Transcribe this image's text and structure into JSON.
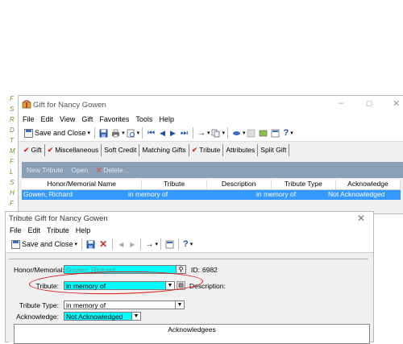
{
  "back_window": {
    "title": "Gift for Nancy Gowen",
    "menu": [
      "File",
      "Edit",
      "View",
      "Gift",
      "Favorites",
      "Tools",
      "Help"
    ],
    "toolbar": {
      "save_close_label": "Save and Close"
    },
    "tabs": [
      "Gift",
      "Miscellaneous",
      "Soft Credit",
      "Matching Gifts",
      "Tribute",
      "Attributes",
      "Split Gift"
    ],
    "checked_tabs": [
      0,
      1,
      4
    ],
    "sub_toolbar": {
      "new_label": "New Tribute",
      "open_label": "Open",
      "delete_label": "Delete..."
    },
    "grid": {
      "headers": [
        "Honor/Memorial Name",
        "Tribute",
        "Description",
        "Tribute Type",
        "Acknowledge"
      ],
      "row": [
        "Gowen, Richard",
        "in memory of",
        "",
        "in memory of",
        "Not Acknowledged"
      ]
    }
  },
  "front_window": {
    "title": "Tribute Gift for Nancy Gowen",
    "menu": [
      "File",
      "Edit",
      "Tribute",
      "Help"
    ],
    "toolbar": {
      "save_close_label": "Save and Close"
    },
    "form": {
      "honor_label": "Honor/Memorial:",
      "honor_value": "Gowen, Richard",
      "id_label": "ID:",
      "id_value": "6982",
      "tribute_label": "Tribute:",
      "tribute_value": "in memory of",
      "description_label": "Description:",
      "tribute_type_label": "Tribute Type:",
      "tribute_type_value": "in memory of",
      "acknowledge_label": "Acknowledge:",
      "acknowledge_value": "Not Acknowledged",
      "acknowledgees_label": "Acknowledgees"
    }
  },
  "side_strip": [
    "F",
    "S",
    "R",
    "D",
    "T",
    "M",
    "F",
    "L",
    "S",
    "H",
    "F"
  ],
  "colors": {
    "selection": "#3399ff",
    "cyan_field": "#00ffff",
    "annotation": "#e01010",
    "sub_toolbar": "#8aa0b8"
  }
}
